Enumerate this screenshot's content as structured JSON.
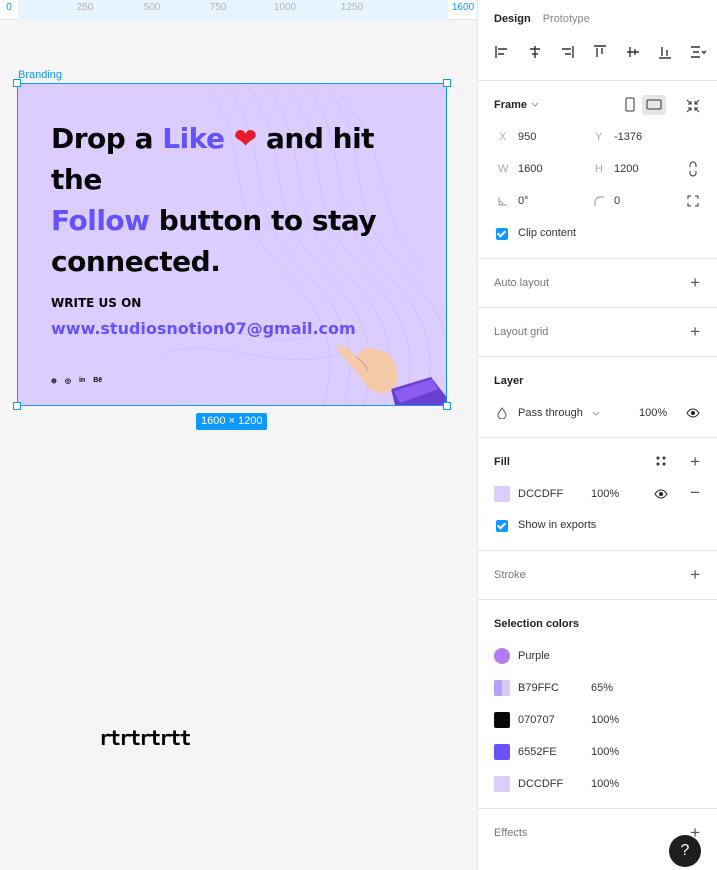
{
  "ruler": {
    "ticks": [
      "0",
      "250",
      "500",
      "750",
      "1000",
      "1250",
      "1600"
    ]
  },
  "canvas": {
    "frame_label": "Branding",
    "size_badge": "1600 × 1200",
    "scribble": "rtrtrtrtt"
  },
  "card": {
    "line1_a": "Drop a ",
    "line1_like": "Like",
    "line1_b": " and hit the",
    "heart": "❤",
    "line2_follow": "Follow",
    "line2_b": " button to stay",
    "line3": "connected.",
    "write_us": "WRITE US ON",
    "email": "www.studiosnotion07@gmail.com",
    "socials": [
      "⊕",
      "◎",
      "in",
      "Bē"
    ]
  },
  "panel": {
    "tabs": {
      "design": "Design",
      "prototype": "Prototype"
    },
    "frame": {
      "title": "Frame",
      "x_label": "X",
      "x": "950",
      "y_label": "Y",
      "y": "-1376",
      "w_label": "W",
      "w": "1600",
      "h_label": "H",
      "h": "1200",
      "rotation": "0°",
      "radius": "0",
      "clip": "Clip content"
    },
    "auto_layout": "Auto layout",
    "layout_grid": "Layout grid",
    "layer": {
      "title": "Layer",
      "mode": "Pass through",
      "opacity": "100%"
    },
    "fill": {
      "title": "Fill",
      "hex": "DCCDFF",
      "opacity": "100%",
      "show_exports": "Show in exports"
    },
    "stroke": "Stroke",
    "selection": {
      "title": "Selection colors",
      "items": [
        {
          "name": "Purple",
          "opacity": ""
        },
        {
          "name": "B79FFC",
          "opacity": "65%"
        },
        {
          "name": "070707",
          "opacity": "100%"
        },
        {
          "name": "6552FE",
          "opacity": "100%"
        },
        {
          "name": "DCCDFF",
          "opacity": "100%"
        }
      ]
    },
    "effects": "Effects",
    "help": "?"
  },
  "colors": {
    "accent": "#0d99ff",
    "frame_fill": "#dccdff",
    "purple_accent": "#6552fe",
    "dark": "#070707",
    "purple_light": "#b79ffc",
    "purple_style": "#b17cf2"
  }
}
